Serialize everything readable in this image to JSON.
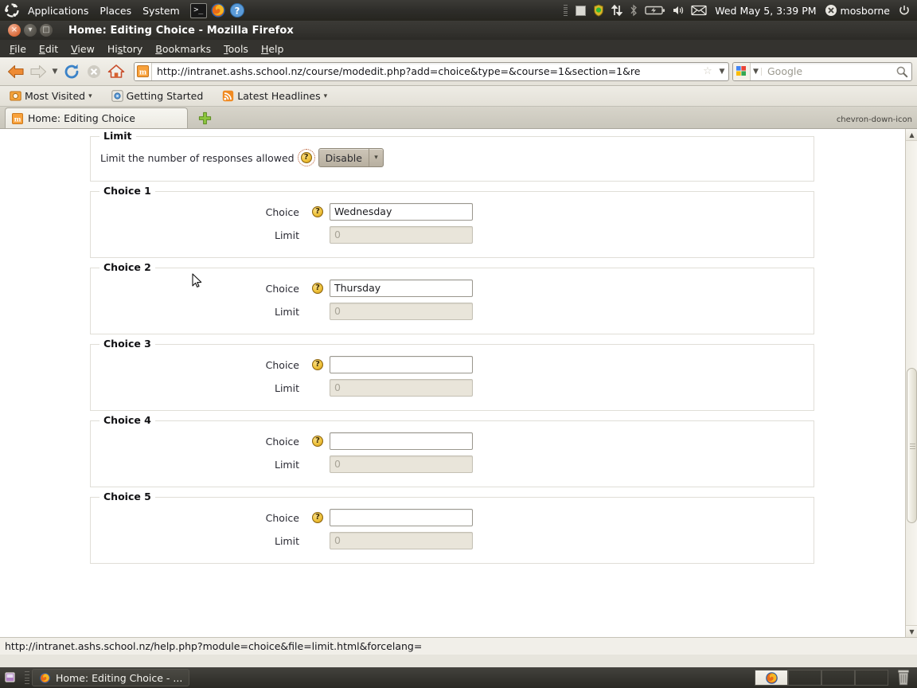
{
  "desktop": {
    "panel": {
      "logo_icon": "ubuntu-logo-icon",
      "menus": [
        "Applications",
        "Places",
        "System"
      ],
      "launchers": [
        {
          "name": "terminal-launcher-icon",
          "glyph": ">_"
        },
        {
          "name": "firefox-launcher-icon",
          "glyph": ""
        },
        {
          "name": "help-launcher-icon",
          "glyph": "?"
        }
      ],
      "tray": {
        "window_icon": "window-indicator-icon",
        "shield_icon": "update-shield-icon",
        "network_icon": "network-up-down-icon",
        "bluetooth_icon": "bluetooth-icon",
        "battery_icon": "battery-icon",
        "volume_icon": "volume-icon",
        "mail_icon": "mail-envelope-icon",
        "clock": "Wed May  5,  3:39 PM",
        "user_icon": "user-status-icon",
        "user": "mosborne",
        "power_icon": "power-icon"
      }
    },
    "taskbar": {
      "show_desktop_icon": "show-desktop-icon",
      "task_icon": "firefox-icon",
      "task_label": "Home: Editing Choice - ...",
      "workspace_count": 4,
      "active_workspace": 1,
      "trash_icon": "trash-icon"
    }
  },
  "browser": {
    "window_title": "Home: Editing Choice - Mozilla Firefox",
    "window_buttons": {
      "close": "×",
      "minimize": "▾",
      "maximize": "□"
    },
    "menubar": [
      "File",
      "Edit",
      "View",
      "History",
      "Bookmarks",
      "Tools",
      "Help"
    ],
    "toolbar": {
      "back_icon": "back-arrow-icon",
      "forward_icon": "forward-arrow-icon",
      "history_dropdown_icon": "chevron-down-icon",
      "reload_icon": "reload-icon",
      "stop_icon": "stop-icon",
      "home_icon": "home-icon"
    },
    "urlbar": {
      "favicon": "moodle-favicon",
      "url": "http://intranet.ashs.school.nz/course/modedit.php?add=choice&type=&course=1&section=1&re",
      "star_icon": "bookmark-star-icon",
      "caret_icon": "chevron-down-icon"
    },
    "searchbar": {
      "engine_icon": "google-icon",
      "engine_caret": "chevron-down-icon",
      "placeholder": "Google",
      "search_icon": "magnifier-icon"
    },
    "bookmarks": [
      {
        "icon": "most-visited-icon",
        "label": "Most Visited",
        "caret": "▾"
      },
      {
        "icon": "getting-started-icon",
        "label": "Getting Started",
        "caret": ""
      },
      {
        "icon": "rss-icon",
        "label": "Latest Headlines",
        "caret": "▾"
      }
    ],
    "tabs": [
      {
        "favicon": "moodle-favicon",
        "label": "Home: Editing Choice"
      }
    ],
    "new_tab_icon": "plus-icon",
    "list_all_tabs_icon": "chevron-down-icon",
    "statusbar": {
      "link_target": "http://intranet.ashs.school.nz/help.php?module=choice&file=limit.html&forcelang="
    },
    "scrollbar": {
      "up_arrow": "▲",
      "down_arrow": "▼"
    }
  },
  "page": {
    "limit_section": {
      "legend": "Limit",
      "field_label": "Limit the number of responses allowed",
      "help_icon_label": "?",
      "select_value": "Disable",
      "select_caret": "▾"
    },
    "choice_sections": [
      {
        "legend": "Choice 1",
        "choice_label": "Choice",
        "choice_value": "Wednesday",
        "limit_label": "Limit",
        "limit_value": "0",
        "help_icon_label": "?"
      },
      {
        "legend": "Choice 2",
        "choice_label": "Choice",
        "choice_value": "Thursday",
        "limit_label": "Limit",
        "limit_value": "0",
        "help_icon_label": "?"
      },
      {
        "legend": "Choice 3",
        "choice_label": "Choice",
        "choice_value": "",
        "limit_label": "Limit",
        "limit_value": "0",
        "help_icon_label": "?"
      },
      {
        "legend": "Choice 4",
        "choice_label": "Choice",
        "choice_value": "",
        "limit_label": "Limit",
        "limit_value": "0",
        "help_icon_label": "?"
      },
      {
        "legend": "Choice 5",
        "choice_label": "Choice",
        "choice_value": "",
        "limit_label": "Limit",
        "limit_value": "0",
        "help_icon_label": "?"
      }
    ]
  },
  "colors": {
    "panel_bg": "#2e2d2a",
    "page_bg": "#ffffff",
    "disabled_field_bg": "#e9e5da",
    "help_icon": "#eec23a",
    "accent_orange": "#d96b3b"
  }
}
